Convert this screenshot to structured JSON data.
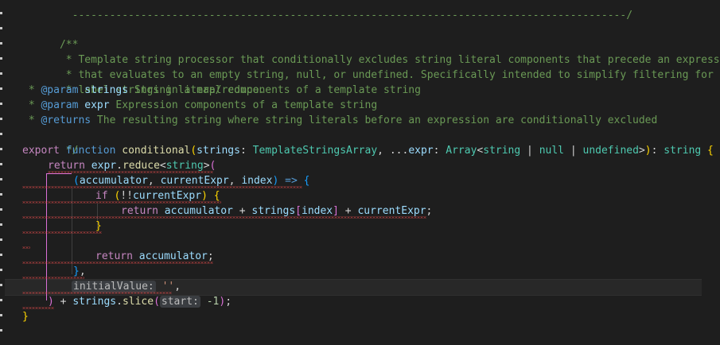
{
  "editor": {
    "top_line": "  -----------------------------------------------------------------------------------------/",
    "comment": {
      "open": "/**",
      "line1": " * Template string processor that conditionally excludes string literal components that precede an expression",
      "line2": " * that evaluates to an empty string, null, or undefined. Specifically intended to simplify filtering for",
      "line3": " * label strings in a map/reduce.",
      "line4_star": " * ",
      "line4_tag": "@param",
      "line4_param": " strings",
      "line4_text": " String literal components of a template string",
      "line5_star": " * ",
      "line5_tag": "@param",
      "line5_param": " expr",
      "line5_text": " Expression components of a template string",
      "line6_star": " * ",
      "line6_tag": "@returns",
      "line6_text": " The resulting string where string literals before an expression are conditionally excluded",
      "close": " */"
    },
    "sig": {
      "export": "export",
      "function": " function",
      "name": " conditional",
      "open_paren": "(",
      "p1": "strings",
      "colon1": ": ",
      "t1": "TemplateStringsArray",
      "comma1": ", ...",
      "p2": "expr",
      "colon2": ": ",
      "t2": "Array",
      "lt": "<",
      "t3": "string",
      "bar1": " | ",
      "t4": "null",
      "bar2": " | ",
      "t5": "undefined",
      "gt": ">",
      "close_paren": ")",
      "colon3": ": ",
      "t6": "string",
      "brace": " {"
    },
    "ret": {
      "kw": "return",
      "obj": " expr",
      "dot": ".",
      "method": "reduce",
      "lt": "<",
      "type": "string",
      "gt": ">",
      "paren": "("
    },
    "cb": {
      "open": "(",
      "a1": "accumulator",
      "comma1": ", ",
      "a2": "currentExpr",
      "comma2": ", ",
      "a3": "index",
      "close": ")",
      "arrow": " =>",
      "brace": " {"
    },
    "if_line": {
      "kw": "if",
      "open": " (",
      "bang": "!!",
      "var": "currentExpr",
      "close": ")",
      "brace": " {"
    },
    "inner_ret": {
      "kw": "return",
      "v1": " accumulator",
      "plus1": " + ",
      "v2": "strings",
      "lb": "[",
      "v3": "index",
      "rb": "]",
      "plus2": " + ",
      "v4": "currentExpr",
      "semi": ";"
    },
    "close_if": "}",
    "ret_acc": {
      "kw": "return",
      "v": " accumulator",
      "semi": ";"
    },
    "close_cb": "}",
    "close_cb_comma": ",",
    "init": {
      "label": "initialValue:",
      "value": " ''",
      "comma": ","
    },
    "tail": {
      "paren": ")",
      "plus": " + ",
      "obj": "strings",
      "dot": ".",
      "method": "slice",
      "open": "(",
      "hint": "start:",
      "val": " -1",
      "close": ")",
      "semi": ";"
    },
    "close_fn": "}"
  },
  "colors": {
    "background": "#1e1e1e",
    "comment": "#6a9955",
    "keyword": "#569cd6",
    "control": "#c586c0",
    "function": "#dcdcaa",
    "type": "#4ec9b0",
    "variable": "#9cdcfe",
    "string": "#ce9178",
    "number": "#b5cea8",
    "error_squiggle": "#f14c4c"
  }
}
